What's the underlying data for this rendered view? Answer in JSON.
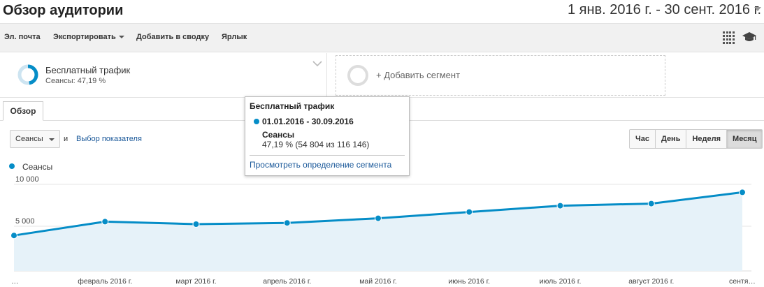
{
  "page": {
    "title": "Обзор аудитории"
  },
  "date_range": {
    "label": "1 янв. 2016 г. - 30 сент. 2016 г."
  },
  "toolbar": {
    "email": "Эл. почта",
    "export": "Экспортировать",
    "add_to_dashboard": "Добавить в сводку",
    "shortcut": "Ярлык"
  },
  "segment": {
    "name": "Бесплатный трафик",
    "sub": "Сеансы: 47,19 %",
    "share": 0.4719,
    "color": "#058dc7"
  },
  "add_segment": {
    "label": "+ Добавить сегмент"
  },
  "tabs": [
    {
      "label": "Обзор",
      "active": true
    }
  ],
  "controls": {
    "metric": "Сеансы",
    "and": "и",
    "pick_metric": "Выбор показателя",
    "periods": [
      {
        "label": "Час",
        "active": false
      },
      {
        "label": "День",
        "active": false
      },
      {
        "label": "Неделя",
        "active": false
      },
      {
        "label": "Месяц",
        "active": true
      }
    ]
  },
  "legend": {
    "label": "Сеансы"
  },
  "tooltip": {
    "title": "Бесплатный трафик",
    "range": "01.01.2016 - 30.09.2016",
    "metric": "Сеансы",
    "value": "47,19 % (54 804 из 116 146)",
    "link": "Просмотреть определение сегмента"
  },
  "chart_data": {
    "type": "area",
    "x": [
      "…",
      "февраль 2016 г.",
      "март 2016 г.",
      "апрель 2016 г.",
      "май 2016 г.",
      "июнь 2016 г.",
      "июль 2016 г.",
      "август 2016 г.",
      "сентя…"
    ],
    "series": [
      {
        "name": "Сеансы",
        "values": [
          3900,
          5550,
          5250,
          5400,
          5950,
          6700,
          7450,
          7700,
          9050
        ]
      }
    ],
    "y_ticks": [
      {
        "value": 10000,
        "label": "10 000"
      },
      {
        "value": 5000,
        "label": "5 000"
      }
    ],
    "ylim": [
      0,
      10000
    ],
    "grid": true,
    "colors": {
      "line": "#058dc7",
      "fill": "#e6f2f9"
    }
  }
}
